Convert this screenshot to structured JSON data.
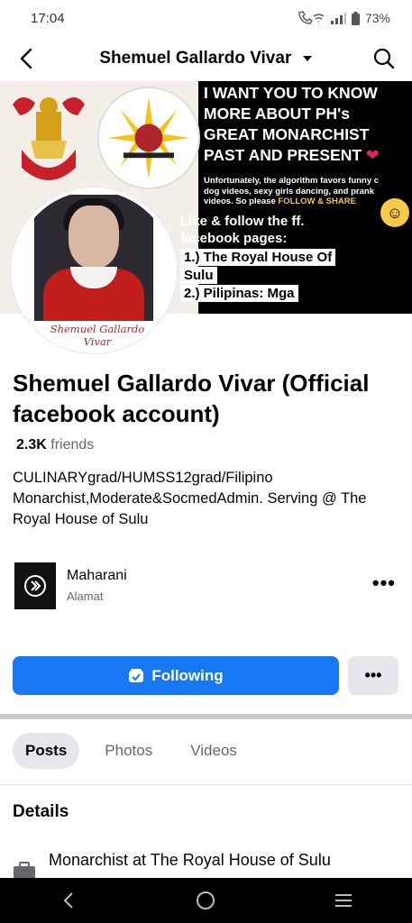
{
  "status": {
    "time": "17:04",
    "battery": "73%"
  },
  "header": {
    "title": "Shemuel Gallardo Vivar"
  },
  "cover": {
    "headline_lines": [
      "I WANT YOU TO KNOW",
      "MORE ABOUT PH's",
      "GREAT MONARCHIST",
      "PAST AND PRESENT"
    ],
    "small_text_1": "Unfortunately, the algorithm favors funny c",
    "small_text_2": "dog videos, sexy girls dancing, and prank",
    "small_text_3": "videos. So please",
    "small_highlight": "FOLLOW & SHARE",
    "like_line_1": "Like & follow the ff.",
    "like_line_2": "facebook pages:",
    "list": [
      "1.) The Royal  House Of",
      "Sulu",
      "2.) Pilipinas: Mga"
    ]
  },
  "avatar": {
    "signature": "Shemuel Gallardo Vivar"
  },
  "profile": {
    "name": "Shemuel Gallardo Vivar (Official facebook account)",
    "friends_count": "2.3K",
    "friends_label": "friends",
    "bio": "CULINARYgrad/HUMSS12grad/Filipino Monarchist,Moderate&SocmedAdmin. Serving @ The Royal House of Sulu"
  },
  "music": {
    "title": "Maharani",
    "artist": "Alamat",
    "more": "•••"
  },
  "actions": {
    "following_label": "Following",
    "more_label": "•••"
  },
  "tabs": [
    {
      "label": "Posts",
      "active": true
    },
    {
      "label": "Photos",
      "active": false
    },
    {
      "label": "Videos",
      "active": false
    }
  ],
  "details": {
    "heading": "Details",
    "work": "Monarchist at The Royal House of Sulu"
  },
  "colors": {
    "accent": "#1877f2",
    "secondary_bg": "#e4e6eb",
    "muted_text": "#65676b"
  }
}
